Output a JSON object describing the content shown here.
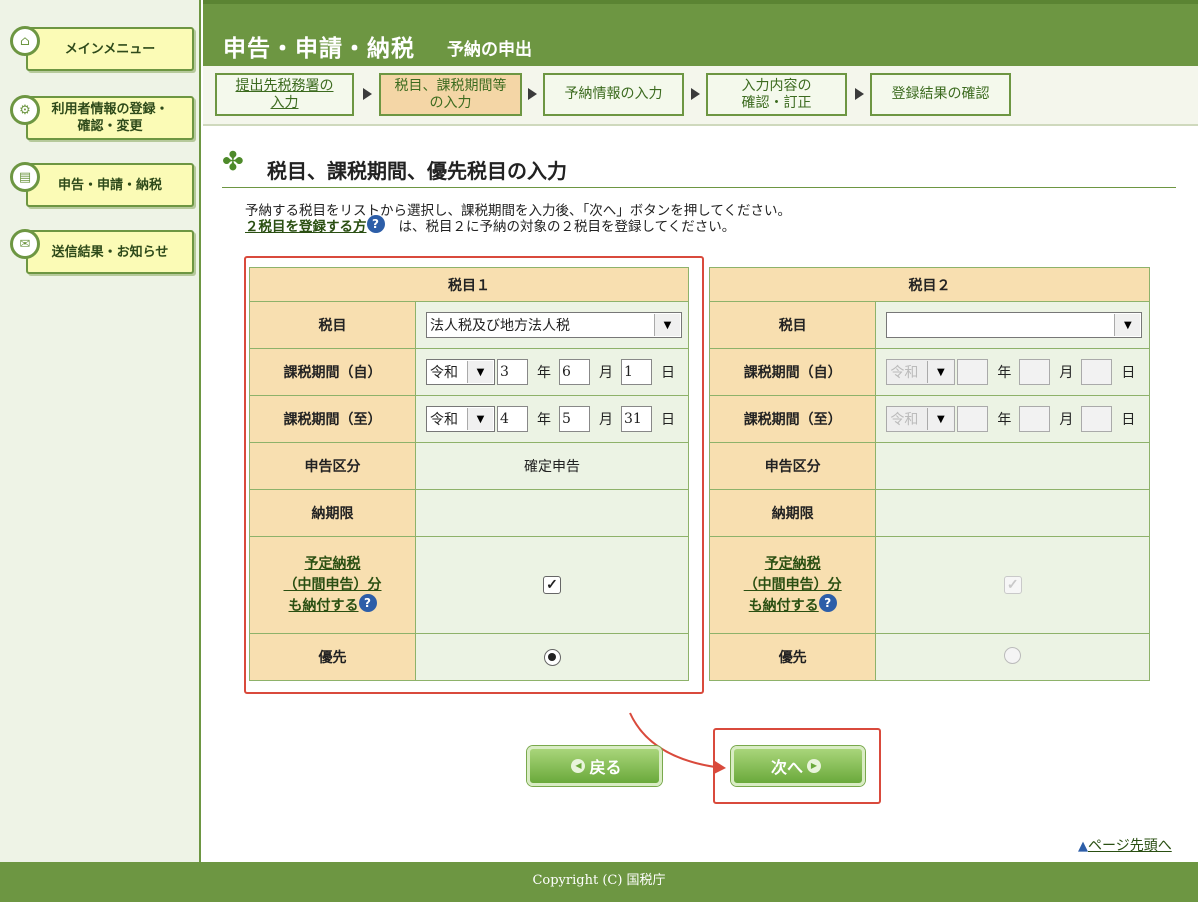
{
  "sidebar": {
    "items": [
      {
        "label": "メインメニュー",
        "icon": "home-icon"
      },
      {
        "label": "利用者情報の登録・\n確認・変更",
        "icon": "user-settings-icon"
      },
      {
        "label": "申告・申請・納税",
        "icon": "document-icon"
      },
      {
        "label": "送信結果・お知らせ",
        "icon": "mail-icon"
      }
    ]
  },
  "header": {
    "title": "申告・申請・納税",
    "subtitle": "予納の申出"
  },
  "steps": [
    {
      "label": "提出先税務署の\n入力"
    },
    {
      "label": "税目、課税期間等\nの入力"
    },
    {
      "label": "予納情報の入力"
    },
    {
      "label": "入力内容の\n確認・訂正"
    },
    {
      "label": "登録結果の確認"
    }
  ],
  "section": {
    "title": "税目、課税期間、優先税目の入力",
    "desc1": "予納する税目をリストから選択し、課税期間を入力後、「次へ」ボタンを押してください。",
    "desc2_link": "２税目を登録する方",
    "desc2_rest": "は、税目２に予納の対象の２税目を登録してください。"
  },
  "labels": {
    "zeimoku": "税目",
    "kikan_from": "課税期間（自）",
    "kikan_to": "課税期間（至）",
    "shinkoku_kubun": "申告区分",
    "nouki": "納期限",
    "yotei_1": "予定納税",
    "yotei_2": "（中間申告）分",
    "yotei_3": "も納付する",
    "yusen": "優先",
    "year": "年",
    "month": "月",
    "day": "日"
  },
  "table1": {
    "header": "税目１",
    "zeimoku_value": "法人税及び地方法人税",
    "from": {
      "era": "令和",
      "year": "3",
      "month": "6",
      "day": "1"
    },
    "to": {
      "era": "令和",
      "year": "4",
      "month": "5",
      "day": "31"
    },
    "shinkoku_kubun": "確定申告",
    "nouki": "",
    "yotei_checked": "✓",
    "yusen_selected": true
  },
  "table2": {
    "header": "税目２",
    "zeimoku_value": "",
    "from": {
      "era": "令和",
      "year": "",
      "month": "",
      "day": ""
    },
    "to": {
      "era": "令和",
      "year": "",
      "month": "",
      "day": ""
    },
    "shinkoku_kubun": "",
    "nouki": "",
    "yotei_checked": "✓",
    "yusen_selected": false
  },
  "buttons": {
    "back": "戻る",
    "next": "次へ"
  },
  "pagetop": "ページ先頭へ",
  "footer": "Copyright (C) 国税庁",
  "help_glyph": "?",
  "colors": {
    "primary_green": "#6d9642",
    "label_bg": "#f8dfb0",
    "value_bg": "#ecf3e4",
    "highlight_red": "#d94a3c",
    "sidebar_button": "#fbfbb6"
  }
}
